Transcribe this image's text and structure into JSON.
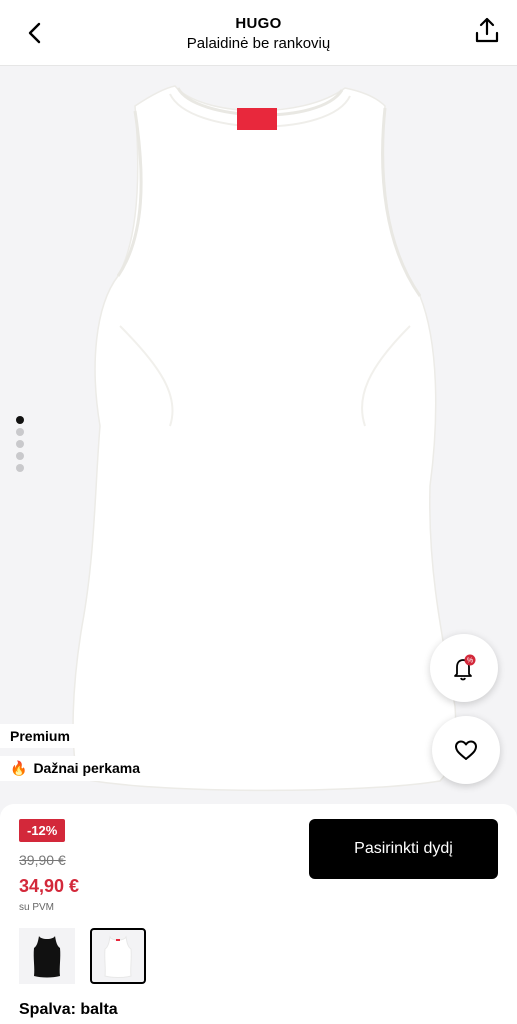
{
  "header": {
    "brand": "HUGO",
    "product_name": "Palaidinė be rankovių"
  },
  "gallery": {
    "image_count": 5,
    "active_index": 0
  },
  "tags": {
    "premium": "Premium",
    "popular": "Dažnai perkama",
    "popular_icon": "🔥"
  },
  "actions": {
    "price_alert_icon": "bell-percent-icon",
    "wishlist_icon": "heart-icon"
  },
  "price": {
    "discount": "-12%",
    "old": "39,90 €",
    "current": "34,90 €",
    "vat_note": "su PVM"
  },
  "cta": {
    "label": "Pasirinkti dydį"
  },
  "color": {
    "label": "Spalva: balta",
    "swatches": [
      "black",
      "white"
    ],
    "selected": "white"
  },
  "colors": {
    "sale_red": "#d3283a",
    "brand_tag_red": "#e8283c"
  }
}
